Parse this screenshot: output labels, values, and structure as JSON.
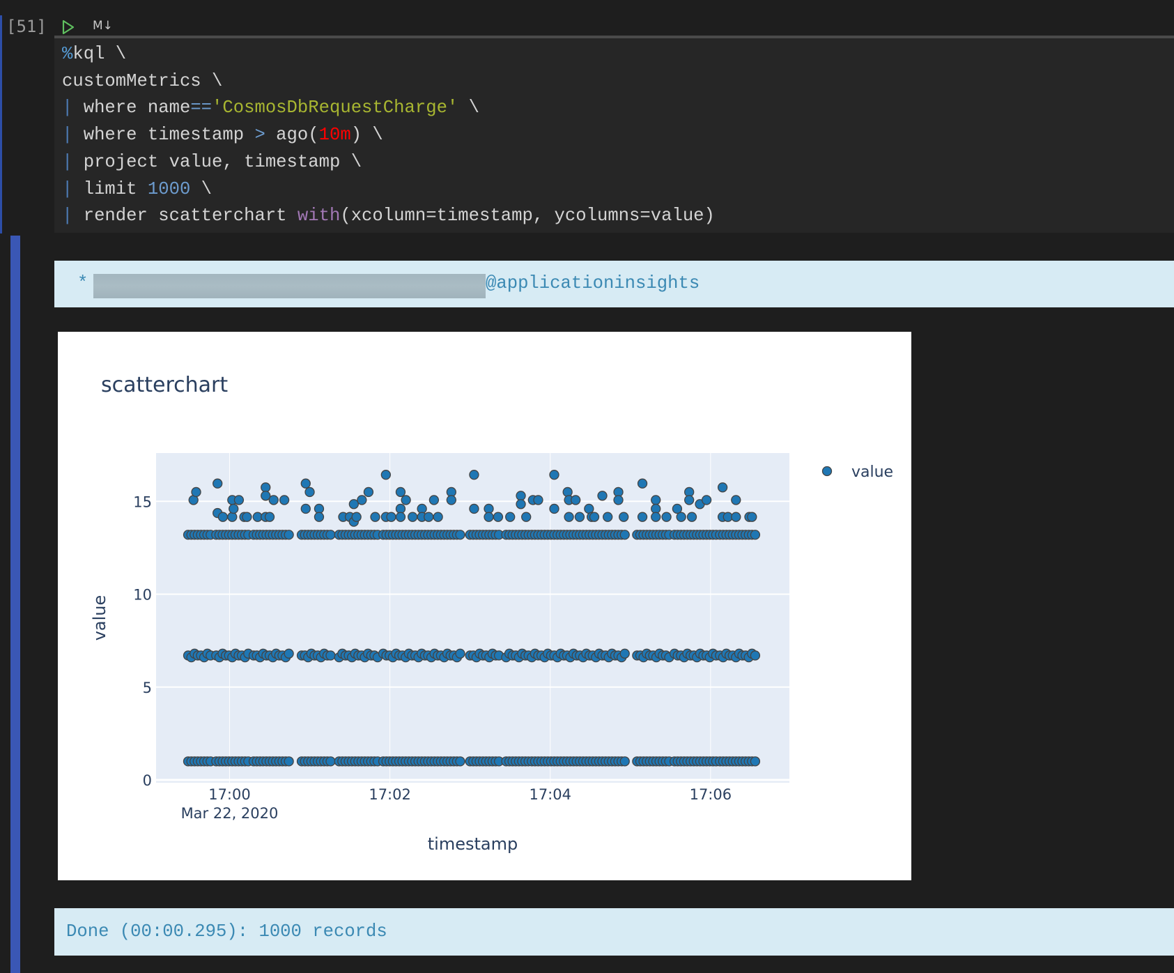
{
  "cell": {
    "execution_count": "[51]",
    "run_icon": "play-icon",
    "markdown_toggle_label": "M↓",
    "code_lines": [
      {
        "parts": [
          {
            "t": "%",
            "c": "kw-blue"
          },
          {
            "t": "kql \\"
          }
        ]
      },
      {
        "parts": [
          {
            "t": "customMetrics \\"
          }
        ]
      },
      {
        "parts": [
          {
            "t": "| ",
            "c": "pipe"
          },
          {
            "t": "where name"
          },
          {
            "t": "==",
            "c": "op"
          },
          {
            "t": "'CosmosDbRequestCharge'",
            "c": "str"
          },
          {
            "t": " \\"
          }
        ]
      },
      {
        "parts": [
          {
            "t": "| ",
            "c": "pipe"
          },
          {
            "t": "where timestamp "
          },
          {
            "t": ">",
            "c": "op"
          },
          {
            "t": " ago("
          },
          {
            "t": "10m",
            "c": "red"
          },
          {
            "t": ") \\"
          }
        ]
      },
      {
        "parts": [
          {
            "t": "| ",
            "c": "pipe"
          },
          {
            "t": "project value, timestamp \\"
          }
        ]
      },
      {
        "parts": [
          {
            "t": "| ",
            "c": "pipe"
          },
          {
            "t": "limit "
          },
          {
            "t": "1000",
            "c": "num"
          },
          {
            "t": " \\"
          }
        ]
      },
      {
        "parts": [
          {
            "t": "| ",
            "c": "pipe"
          },
          {
            "t": "render scatterchart "
          },
          {
            "t": "with",
            "c": "purple"
          },
          {
            "t": "(xcolumn=timestamp, ycolumns=value)"
          }
        ]
      }
    ]
  },
  "output": {
    "connection_prefix": "*",
    "connection_suffix": "@applicationinsights",
    "status": "Done (00:00.295): 1000 records"
  },
  "colors": {
    "marker": "#1f77b4",
    "marker_edge": "#444444",
    "plot_bg": "#e5ecf6",
    "accent": "#3a57b5"
  },
  "chart_data": {
    "type": "scatter",
    "title": "scatterchart",
    "xlabel": "timestamp",
    "ylabel": "value",
    "x_unit": "seconds after 2020-03-22 17:00:00",
    "xlim": [
      -55,
      419
    ],
    "ylim": [
      -0.15,
      17.6
    ],
    "x_ticks": [
      {
        "v": 0,
        "label": "17:00",
        "sublabel": "Mar 22, 2020"
      },
      {
        "v": 120,
        "label": "17:02"
      },
      {
        "v": 240,
        "label": "17:04"
      },
      {
        "v": 360,
        "label": "17:06"
      }
    ],
    "y_ticks": [
      {
        "v": 0,
        "label": "0"
      },
      {
        "v": 5,
        "label": "5"
      },
      {
        "v": 10,
        "label": "10"
      },
      {
        "v": 15,
        "label": "15"
      }
    ],
    "legend": {
      "position": "top-right",
      "entries": [
        "value"
      ]
    },
    "series": [
      {
        "name": "value",
        "bands": [
          {
            "values": [
              13.2
            ],
            "spacing_s": 2.4
          },
          {
            "values": [
              6.7,
              6.6,
              6.8,
              6.7
            ],
            "spacing_s": 2.4
          },
          {
            "values": [
              1.0
            ],
            "spacing_s": 2.4
          }
        ],
        "band_segments": [
          [
            -31,
            -14
          ],
          [
            -10,
            15
          ],
          [
            18,
            46
          ],
          [
            54,
            77
          ],
          [
            82,
            112
          ],
          [
            115,
            174
          ],
          [
            180,
            204
          ],
          [
            207,
            298
          ],
          [
            305,
            330
          ],
          [
            333,
            365
          ],
          [
            367,
            394
          ]
        ],
        "points": [
          [
            -27,
            15.07
          ],
          [
            -25,
            15.5
          ],
          [
            -9,
            15.96
          ],
          [
            -9,
            14.37
          ],
          [
            -5,
            14.16
          ],
          [
            2,
            15.07
          ],
          [
            2,
            14.16
          ],
          [
            3,
            14.6
          ],
          [
            7,
            15.07
          ],
          [
            11,
            14.16
          ],
          [
            13,
            14.16
          ],
          [
            21,
            14.16
          ],
          [
            27,
            15.75
          ],
          [
            27,
            15.3
          ],
          [
            27,
            14.16
          ],
          [
            30,
            14.16
          ],
          [
            33,
            15.07
          ],
          [
            41,
            15.07
          ],
          [
            57,
            15.96
          ],
          [
            60,
            15.5
          ],
          [
            57,
            14.6
          ],
          [
            67,
            14.6
          ],
          [
            67,
            14.16
          ],
          [
            85,
            14.16
          ],
          [
            90,
            14.16
          ],
          [
            93,
            14.85
          ],
          [
            93,
            13.9
          ],
          [
            95,
            14.16
          ],
          [
            99,
            15.07
          ],
          [
            104,
            15.5
          ],
          [
            109,
            14.16
          ],
          [
            117,
            16.43
          ],
          [
            117,
            14.16
          ],
          [
            121,
            14.16
          ],
          [
            128,
            15.5
          ],
          [
            128,
            14.6
          ],
          [
            128,
            14.16
          ],
          [
            132,
            15.07
          ],
          [
            137,
            14.16
          ],
          [
            144,
            14.6
          ],
          [
            144,
            14.16
          ],
          [
            149,
            14.16
          ],
          [
            153,
            15.07
          ],
          [
            156,
            14.16
          ],
          [
            166,
            15.5
          ],
          [
            166,
            15.07
          ],
          [
            183,
            16.43
          ],
          [
            183,
            14.6
          ],
          [
            194,
            14.6
          ],
          [
            194,
            14.16
          ],
          [
            201,
            14.16
          ],
          [
            210,
            14.16
          ],
          [
            218,
            15.3
          ],
          [
            218,
            14.85
          ],
          [
            222,
            14.16
          ],
          [
            227,
            15.07
          ],
          [
            231,
            15.07
          ],
          [
            243,
            16.43
          ],
          [
            243,
            14.6
          ],
          [
            253,
            15.5
          ],
          [
            254,
            15.07
          ],
          [
            254,
            14.16
          ],
          [
            259,
            15.07
          ],
          [
            262,
            14.16
          ],
          [
            269,
            14.6
          ],
          [
            271,
            14.16
          ],
          [
            273,
            14.16
          ],
          [
            279,
            15.3
          ],
          [
            283,
            14.16
          ],
          [
            291,
            15.5
          ],
          [
            291,
            15.07
          ],
          [
            295,
            14.16
          ],
          [
            309,
            15.96
          ],
          [
            309,
            14.16
          ],
          [
            319,
            15.07
          ],
          [
            319,
            14.6
          ],
          [
            319,
            14.16
          ],
          [
            327,
            14.16
          ],
          [
            335,
            14.6
          ],
          [
            338,
            14.16
          ],
          [
            344,
            15.5
          ],
          [
            344,
            15.07
          ],
          [
            346,
            14.16
          ],
          [
            352,
            14.85
          ],
          [
            357,
            15.07
          ],
          [
            369,
            15.75
          ],
          [
            369,
            14.16
          ],
          [
            373,
            14.16
          ],
          [
            379,
            15.07
          ],
          [
            379,
            14.16
          ],
          [
            389,
            14.16
          ],
          [
            391,
            14.16
          ]
        ]
      }
    ]
  }
}
